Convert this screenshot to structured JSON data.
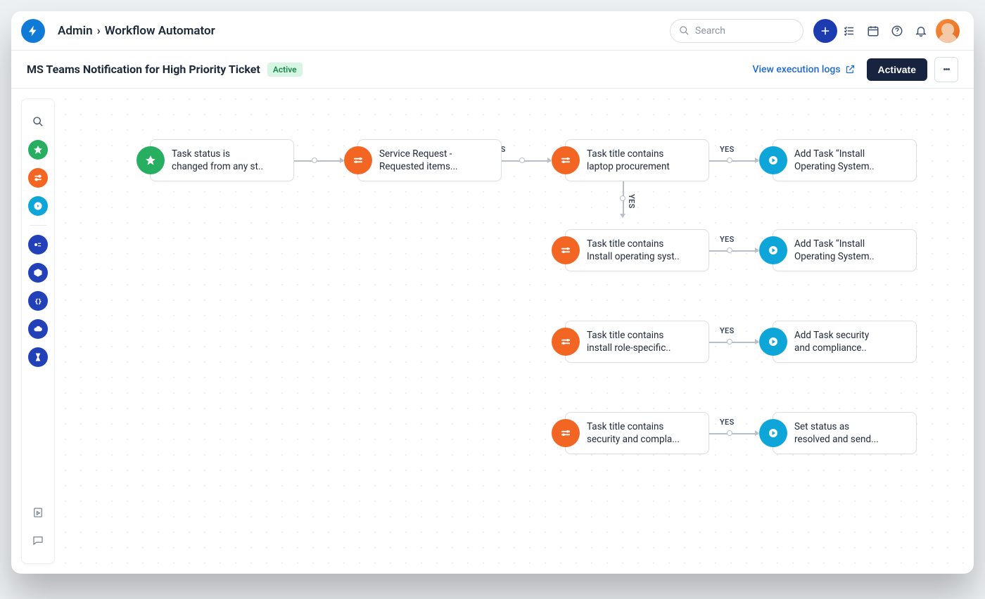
{
  "breadcrumb": {
    "root": "Admin",
    "page": "Workflow Automator"
  },
  "search": {
    "placeholder": "Search"
  },
  "subheader": {
    "title": "MS Teams Notification for High Priority Ticket",
    "status_badge": "Active",
    "logs_link": "View execution logs",
    "activate_button": "Activate"
  },
  "branch_labels": {
    "yes": "YES"
  },
  "nodes": {
    "trigger": {
      "line1": "Task status is",
      "line2": "changed from any st.."
    },
    "cond1": {
      "line1": "Service Request -",
      "line2": "Requested items..."
    },
    "cond2": {
      "line1": "Task title contains",
      "line2": "laptop procurement"
    },
    "action2a": {
      "line1": "Add Task “Install",
      "line2": "Operating System.."
    },
    "cond3": {
      "line1": "Task title contains",
      "line2": "Install operating syst.."
    },
    "action3a": {
      "line1": "Add Task “Install",
      "line2": "Operating System.."
    },
    "cond4": {
      "line1": "Task title contains",
      "line2": "install role-specific.."
    },
    "action4a": {
      "line1": "Add Task security",
      "line2": "and compliance.."
    },
    "cond5": {
      "line1": "Task title contains",
      "line2": "security and compla..."
    },
    "action5a": {
      "line1": "Set status as",
      "line2": "resolved and send..."
    }
  },
  "toolbox_items": [
    "search",
    "trigger",
    "condition",
    "action",
    "form",
    "package",
    "webhook",
    "cloud",
    "timer"
  ]
}
